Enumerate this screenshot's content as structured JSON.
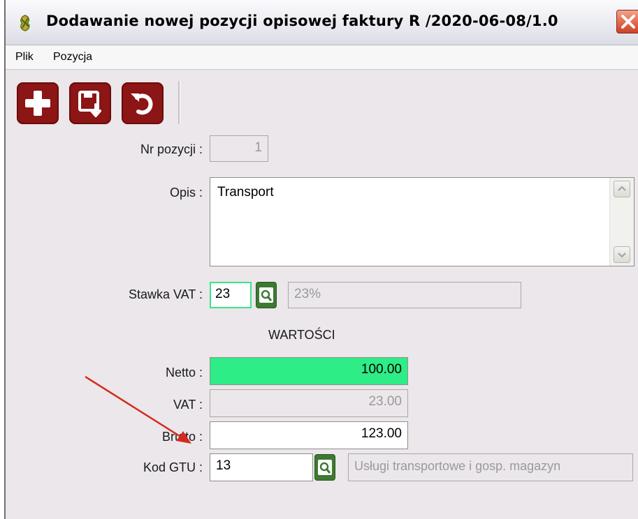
{
  "window": {
    "title": "Dodawanie nowej pozycji opisowej faktury R /2020-06-08/1.0"
  },
  "menu": {
    "items": [
      "Plik",
      "Pozycja"
    ]
  },
  "toolbar": {
    "buttons": [
      "add-icon",
      "save-icon",
      "undo-icon"
    ]
  },
  "form": {
    "nr_pozycji": {
      "label": "Nr pozycji :",
      "value": "1"
    },
    "opis": {
      "label": "Opis :",
      "value": "Transport"
    },
    "stawka_vat": {
      "label": "Stawka VAT :",
      "code": "23",
      "description": "23%"
    },
    "wartosci": {
      "section_title": "WARTOŚCI",
      "netto": {
        "label": "Netto :",
        "value": "100.00"
      },
      "vat": {
        "label": "VAT :",
        "value": "23.00"
      },
      "brutto": {
        "label": "Brutto :",
        "value": "123.00"
      }
    },
    "kod_gtu": {
      "label": "Kod GTU :",
      "code": "13",
      "description": "Usługi transportowe i gosp. magazyn"
    }
  },
  "colors": {
    "toolbar_button": "#8c1515",
    "lookup_button": "#3d7a31",
    "netto_highlight": "#2eec86",
    "annotation_arrow": "#d42a1f"
  }
}
